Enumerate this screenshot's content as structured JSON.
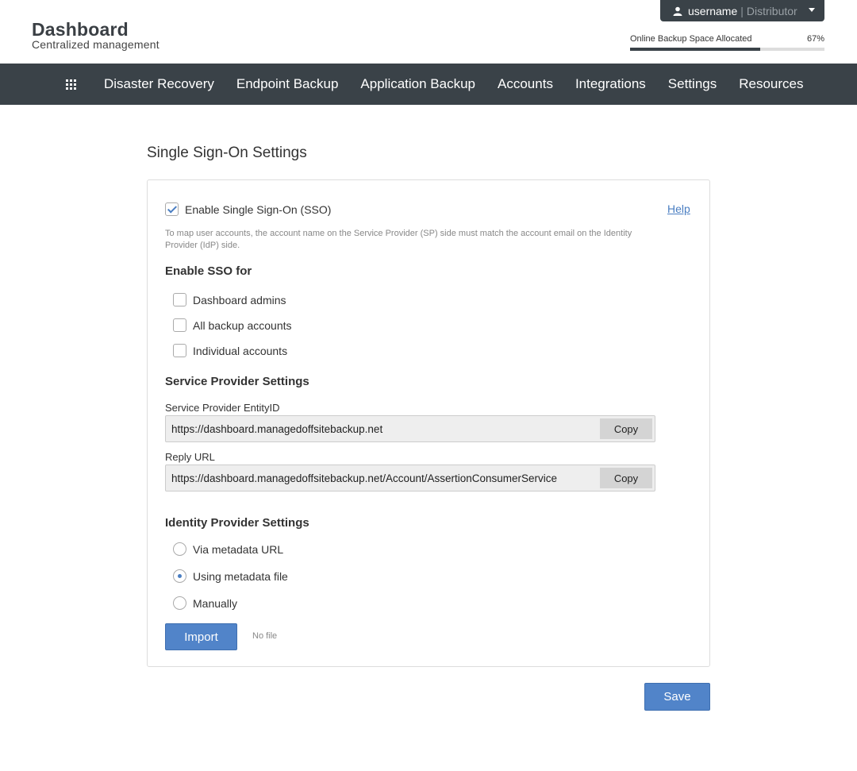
{
  "header": {
    "title": "Dashboard",
    "subtitle": "Centralized management",
    "user": {
      "name": "username",
      "separator": "|",
      "role": "Distributor",
      "icon": "user-icon"
    },
    "backup_space": {
      "label": "Online Backup Space Allocated",
      "percent_text": "67%",
      "fraction": 0.67
    }
  },
  "nav": {
    "apps_icon": "grid-icon",
    "items": [
      {
        "label": "Disaster Recovery"
      },
      {
        "label": "Endpoint Backup"
      },
      {
        "label": "Application Backup"
      },
      {
        "label": "Accounts"
      },
      {
        "label": "Integrations"
      },
      {
        "label": "Settings"
      },
      {
        "label": "Resources"
      }
    ]
  },
  "page": {
    "title": "Single Sign-On Settings"
  },
  "sso": {
    "enable_label": "Enable Single Sign-On (SSO)",
    "enabled": true,
    "help_label": "Help",
    "note": "To map user accounts, the account name on the Service Provider (SP) side must match the account email on the Identity Provider (IdP) side.",
    "enable_for_heading": "Enable SSO for",
    "enable_for": [
      {
        "label": "Dashboard admins",
        "checked": false
      },
      {
        "label": "All backup accounts",
        "checked": false
      },
      {
        "label": "Individual accounts",
        "checked": false
      }
    ],
    "sp_heading": "Service Provider Settings",
    "entity_id_label": "Service Provider EntityID",
    "entity_id_value": "https://dashboard.managedoffsitebackup.net",
    "reply_url_label": "Reply URL",
    "reply_url_value": "https://dashboard.managedoffsitebackup.net/Account/AssertionConsumerService",
    "copy_label": "Copy",
    "idp_heading": "Identity Provider Settings",
    "idp_options": [
      {
        "label": "Via metadata URL",
        "selected": false
      },
      {
        "label": "Using metadata file",
        "selected": true
      },
      {
        "label": "Manually",
        "selected": false
      }
    ],
    "import_label": "Import",
    "no_file_label": "No file"
  },
  "footer": {
    "save_label": "Save"
  },
  "colors": {
    "navbar": "#3a4248",
    "primary": "#5184c9",
    "link": "#4a7ec2"
  }
}
